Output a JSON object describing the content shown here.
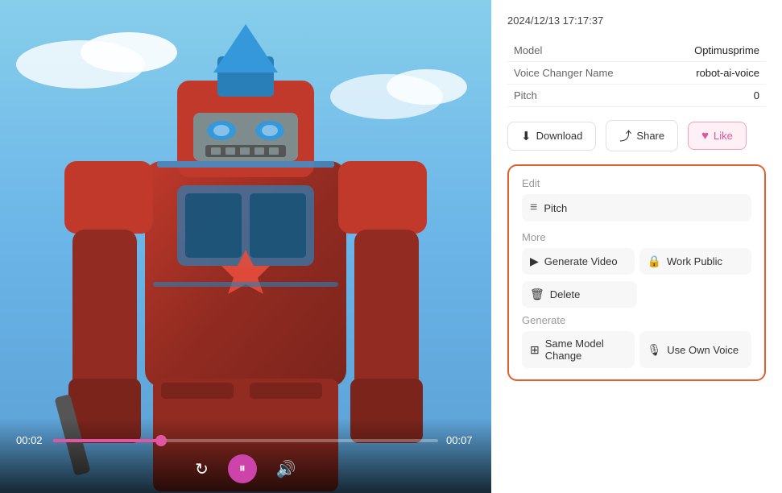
{
  "timestamp": "2024/12/13 17:17:37",
  "info": {
    "model_label": "Model",
    "model_value": "Optimusprime",
    "voice_changer_label": "Voice Changer Name",
    "voice_changer_value": "robot-ai-voice",
    "pitch_label": "Pitch",
    "pitch_value": "0"
  },
  "actions": {
    "download_label": "Download",
    "share_label": "Share",
    "like_label": "Like"
  },
  "edit_section": {
    "edit_label": "Edit",
    "pitch_item_label": "Pitch",
    "more_label": "More",
    "generate_video_label": "Generate Video",
    "work_public_label": "Work Public",
    "delete_label": "Delete",
    "generate_label": "Generate",
    "same_model_label": "Same Model Change",
    "use_own_voice_label": "Use Own Voice"
  },
  "player": {
    "current_time": "00:02",
    "total_time": "00:07",
    "progress_percent": 28
  },
  "icons": {
    "download": "↓",
    "share": "⤴",
    "like_heart": "♥",
    "repeat": "↻",
    "play_pause": "⏸",
    "volume": "🔊",
    "pitch_icon": "≡",
    "video_icon": "▶",
    "lock_icon": "🔒",
    "trash_icon": "🗑",
    "model_change_icon": "⊞",
    "mic_icon": "🎙"
  }
}
